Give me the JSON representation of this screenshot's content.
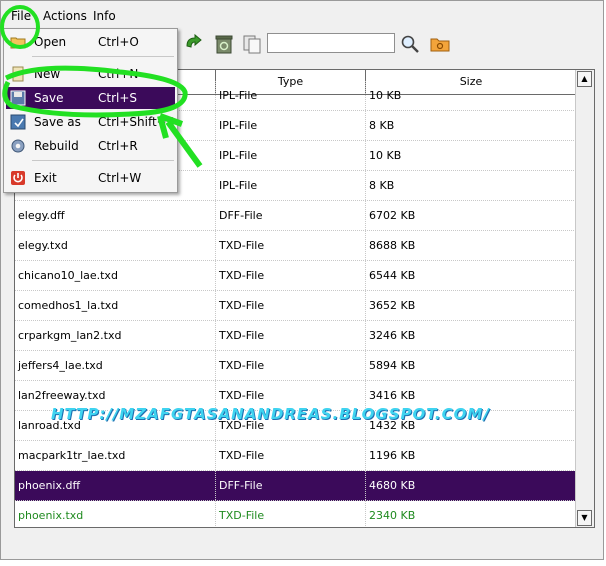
{
  "menubar": {
    "file": "File",
    "actions": "Actions",
    "info": "Info"
  },
  "toolbar": {
    "search_value": ""
  },
  "file_menu": {
    "items": [
      {
        "label": "Open",
        "shortcut": "Ctrl+O",
        "icon": "open-folder-icon"
      },
      {
        "label": "New",
        "shortcut": "Ctrl+N",
        "icon": "new-document-icon"
      },
      {
        "label": "Save",
        "shortcut": "Ctrl+S",
        "icon": "floppy-disk-icon"
      },
      {
        "label": "Save as",
        "shortcut": "Ctrl+Shift+S",
        "icon": "save-as-icon"
      },
      {
        "label": "Rebuild",
        "shortcut": "Ctrl+R",
        "icon": "gear-icon"
      },
      {
        "label": "Exit",
        "shortcut": "Ctrl+W",
        "icon": "power-icon"
      }
    ]
  },
  "table": {
    "columns": [
      "Type",
      "Size"
    ],
    "rows": [
      {
        "name": "",
        "type": "IPL-File",
        "size": "10 KB"
      },
      {
        "name": "",
        "type": "IPL-File",
        "size": "8 KB"
      },
      {
        "name": "",
        "type": "IPL-File",
        "size": "10 KB"
      },
      {
        "name": "",
        "type": "IPL-File",
        "size": "8 KB"
      },
      {
        "name": "elegy.dff",
        "type": "DFF-File",
        "size": "6702 KB"
      },
      {
        "name": "elegy.txd",
        "type": "TXD-File",
        "size": "8688 KB"
      },
      {
        "name": "chicano10_lae.txd",
        "type": "TXD-File",
        "size": "6544 KB"
      },
      {
        "name": "comedhos1_la.txd",
        "type": "TXD-File",
        "size": "3652 KB"
      },
      {
        "name": "crparkgm_lan2.txd",
        "type": "TXD-File",
        "size": "3246 KB"
      },
      {
        "name": "jeffers4_lae.txd",
        "type": "TXD-File",
        "size": "5894 KB"
      },
      {
        "name": "lan2freeway.txd",
        "type": "TXD-File",
        "size": "3416 KB"
      },
      {
        "name": "lanroad.txd",
        "type": "TXD-File",
        "size": "1432 KB"
      },
      {
        "name": "macpark1tr_lae.txd",
        "type": "TXD-File",
        "size": "1196 KB"
      },
      {
        "name": "phoenix.dff",
        "type": "DFF-File",
        "size": "4680 KB"
      },
      {
        "name": "phoenix.txd",
        "type": "TXD-File",
        "size": "2340 KB"
      }
    ]
  },
  "watermark": "HTTP://MZAFGTASANANDREAS.BLOGSPOT.COM/",
  "colors": {
    "selection": "#3b0a5a",
    "annotation": "#22e022",
    "watermark": "#3fd3f0",
    "green_text": "#1f8a1f"
  }
}
